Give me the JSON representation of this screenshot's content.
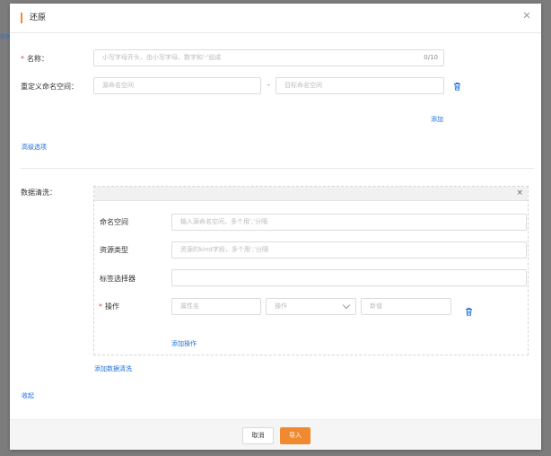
{
  "background": {
    "link_text": "持久化"
  },
  "dialog": {
    "title": "还原",
    "accent_color": "#f08a30",
    "link_color": "#1e6fd9"
  },
  "form": {
    "name": {
      "required_mark": "*",
      "label": "名称：",
      "placeholder": "小写字母开头，由小写字母、数字和'-'组成",
      "counter": "0/10"
    },
    "namespace_remap": {
      "label": "重定义命名空间：",
      "source_placeholder": "源命名空间",
      "separator": "-",
      "target_placeholder": "目标命名空间",
      "add_label": "添加"
    },
    "advanced_label": "高级选项",
    "data_wash": {
      "label": "数据清洗：",
      "close": "×",
      "namespace": {
        "label": "命名空间",
        "placeholder": "输入源命名空间，多个用','分隔"
      },
      "resource_type": {
        "label": "资源类型",
        "placeholder": "资源的kind字段，多个用','分隔"
      },
      "label_selector": {
        "label": "标签选择器",
        "value": ""
      },
      "operation": {
        "required_mark": "*",
        "label": "操作",
        "attr_placeholder": "属性名",
        "op_placeholder": "操作",
        "new_value_placeholder": "新值"
      },
      "add_operation_label": "添加操作"
    },
    "add_wash_label": "添加数据清洗",
    "collapse_label": "收起"
  },
  "footer": {
    "cancel_label": "取消",
    "import_label": "导入"
  }
}
